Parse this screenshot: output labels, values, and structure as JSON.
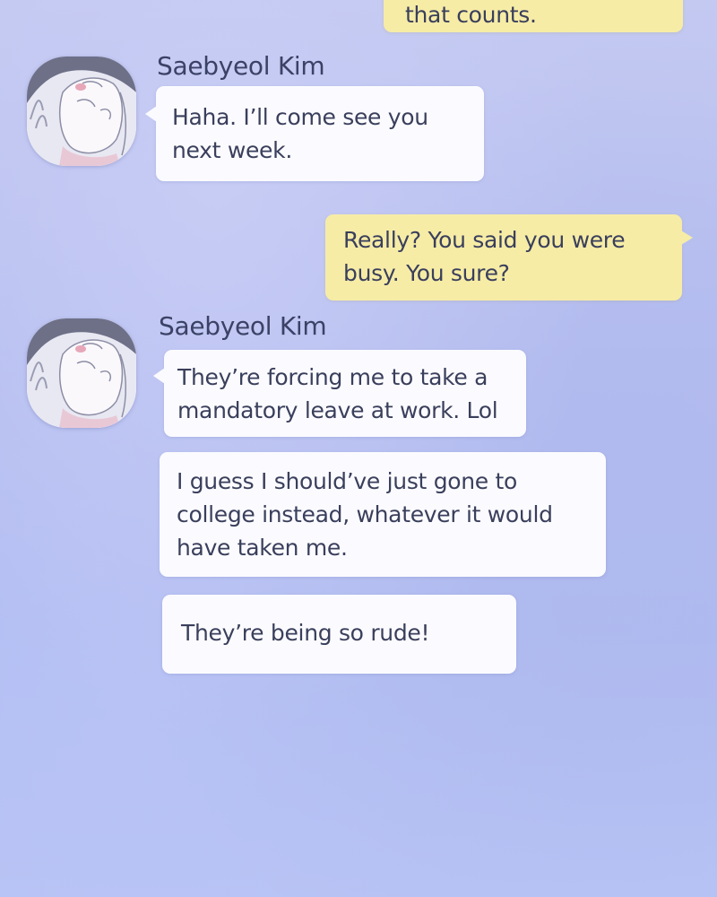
{
  "messages": [
    {
      "type": "outgoing",
      "text": "that counts."
    },
    {
      "type": "incoming",
      "sender": "Saebyeol Kim",
      "lines": [
        "Haha. I’ll come see you",
        "next week."
      ]
    },
    {
      "type": "outgoing",
      "lines": [
        "Really? You said you were",
        "busy. You sure?"
      ]
    },
    {
      "type": "incoming",
      "sender": "Saebyeol Kim",
      "lines": [
        "They’re forcing me to take a",
        "mandatory leave at work. Lol"
      ]
    },
    {
      "type": "incoming",
      "lines": [
        "I guess I should’ve just gone to",
        "college instead, whatever it would",
        "have taken me."
      ]
    },
    {
      "type": "incoming",
      "lines": [
        "They’re being so rude!"
      ]
    }
  ],
  "colors": {
    "incoming_bubble": "#fbfbff",
    "outgoing_bubble": "#f6eca6",
    "text": "#3a3f5c",
    "background": "#b5bdef"
  },
  "icons": {
    "avatar": "avatar-hand-covering-face-icon"
  }
}
